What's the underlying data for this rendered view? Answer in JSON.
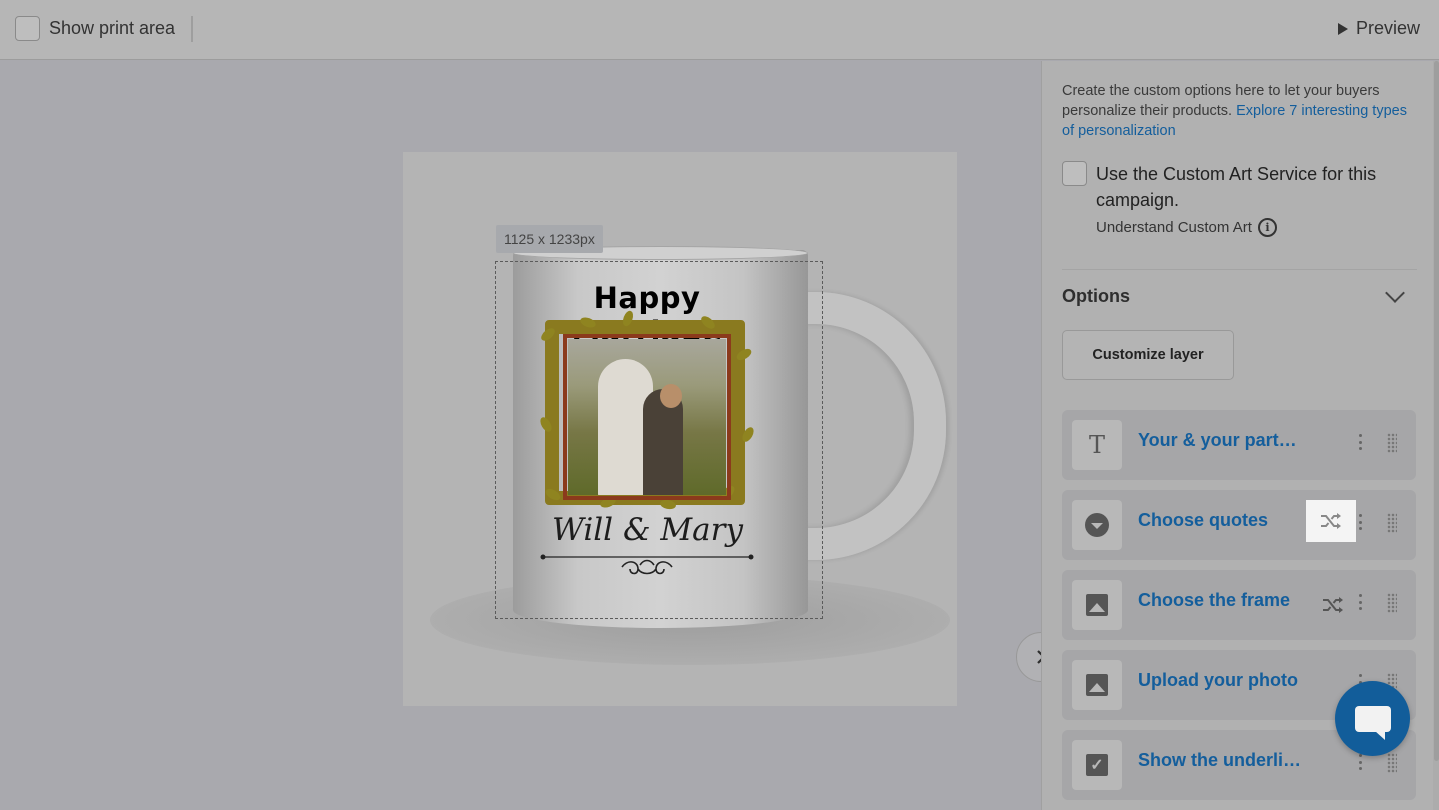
{
  "toolbar": {
    "show_print_area_label": "Show print area",
    "preview_label": "Preview"
  },
  "canvas": {
    "dimension_label": "1125 x 1233px",
    "design_title": "Happy Marriage",
    "design_names": "Will & Mary",
    "collapse_icon": "chevron-right-icon"
  },
  "panel": {
    "intro_text": "Create the custom options here to let your buyers personalize their products. ",
    "intro_link": "Explore 7 interesting types of personalization",
    "custom_art_label": "Use the Custom Art Service for this campaign.",
    "understand_custom_art": "Understand Custom Art",
    "options_title": "Options",
    "customize_layer_button": "Customize layer",
    "options": [
      {
        "label": "Your & your part…",
        "icon": "text-icon",
        "shuffle": false
      },
      {
        "label": "Choose quotes",
        "icon": "dropdown-icon",
        "shuffle": true,
        "shuffle_highlighted": true
      },
      {
        "label": "Choose the frame",
        "icon": "image-icon",
        "shuffle": true
      },
      {
        "label": "Upload your photo",
        "icon": "image-icon",
        "shuffle": false
      },
      {
        "label": "Show the underli…",
        "icon": "checkbox-icon",
        "shuffle": false
      }
    ]
  },
  "colors": {
    "link": "#145e9c",
    "chat_button": "#125d9a",
    "overlay_bg": "#a9a9ae"
  }
}
